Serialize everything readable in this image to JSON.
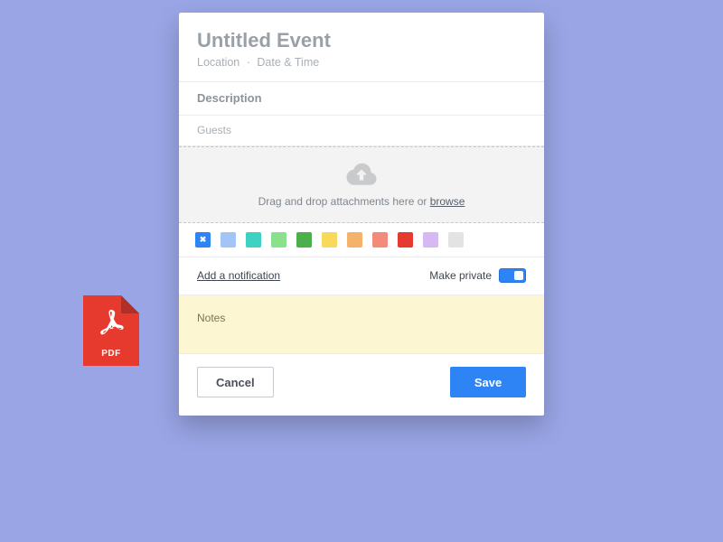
{
  "pdf_file": {
    "label": "PDF",
    "icon": "adobe-acrobat-icon"
  },
  "dialog": {
    "title": "Untitled Event",
    "subline": {
      "location": "Location",
      "datetime": "Date & Time"
    },
    "description_label": "Description",
    "guests_label": "Guests",
    "dropzone": {
      "text": "Drag and drop attachments here or ",
      "browse": "browse",
      "icon": "cloud-upload-icon"
    },
    "swatches": [
      {
        "color": "#2f84f5",
        "selected": true
      },
      {
        "color": "#a2c4f7",
        "selected": false
      },
      {
        "color": "#3ed2c3",
        "selected": false
      },
      {
        "color": "#8be08b",
        "selected": false
      },
      {
        "color": "#4bb04b",
        "selected": false
      },
      {
        "color": "#f9d95b",
        "selected": false
      },
      {
        "color": "#f4b26a",
        "selected": false
      },
      {
        "color": "#f28b7a",
        "selected": false
      },
      {
        "color": "#e63a2e",
        "selected": false
      },
      {
        "color": "#d6b8f4",
        "selected": false
      },
      {
        "color": "#e3e3e3",
        "selected": false
      }
    ],
    "options": {
      "add_notification": "Add a notification",
      "make_private": "Make private",
      "private_on": true
    },
    "notes_label": "Notes",
    "buttons": {
      "cancel": "Cancel",
      "save": "Save"
    }
  }
}
